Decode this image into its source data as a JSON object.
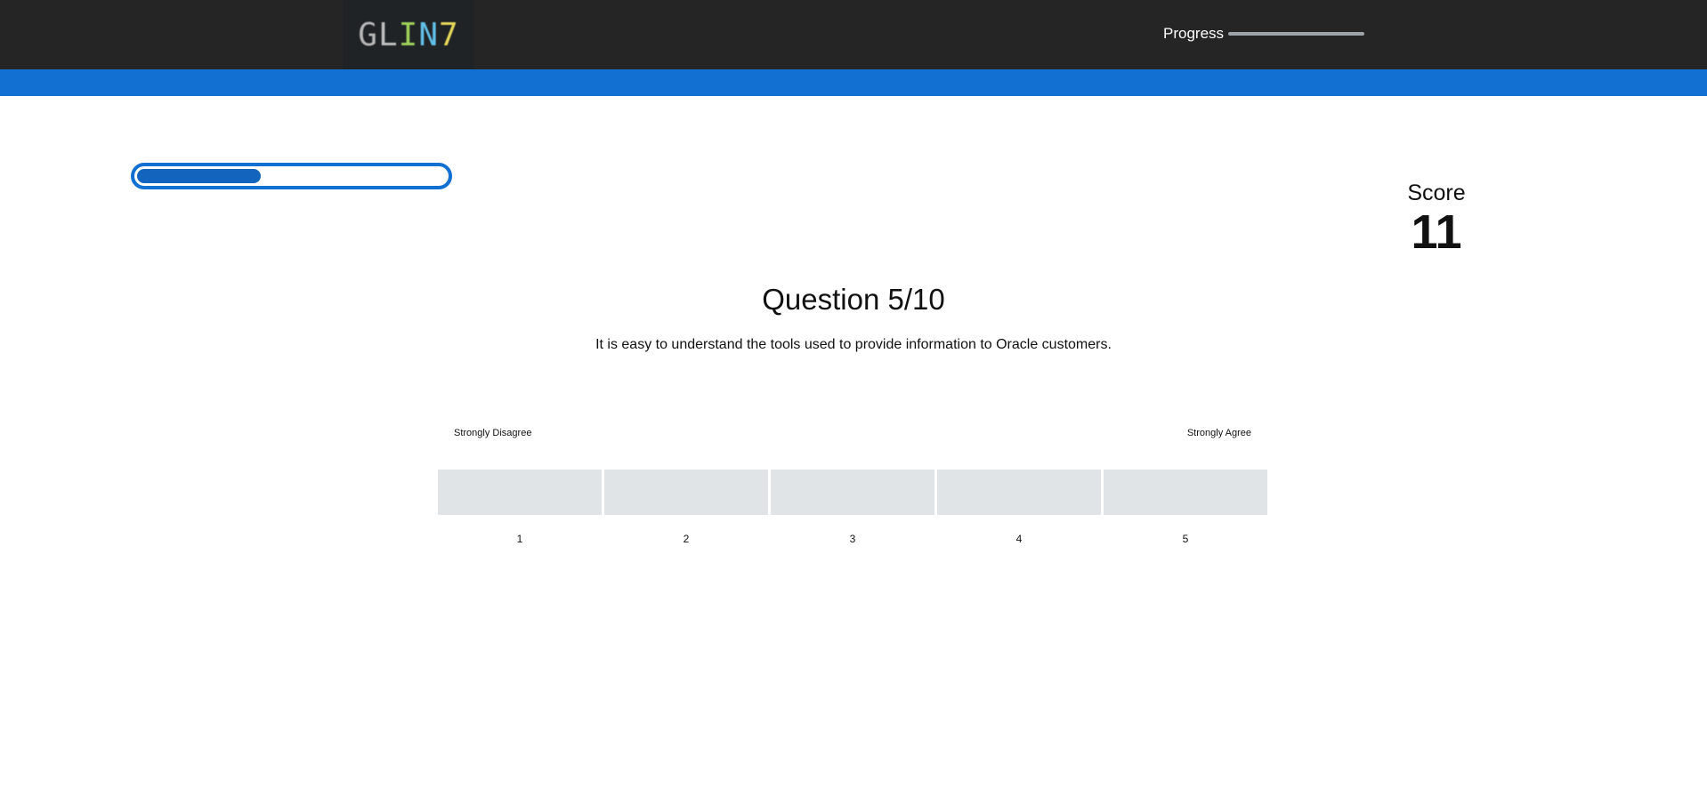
{
  "header": {
    "logo_text": [
      "G",
      "L",
      "I",
      "N",
      "7"
    ],
    "progress_label": "Progress",
    "progress_value": 0
  },
  "quiz_progress": {
    "value": 0.4
  },
  "score": {
    "label": "Score",
    "value": "11"
  },
  "question": {
    "title": "Question 5/10",
    "text": "It is easy to understand the tools used to provide information to Oracle customers."
  },
  "scale": {
    "low_label": "Strongly Disagree",
    "high_label": "Strongly Agree",
    "options": [
      "1",
      "2",
      "3",
      "4",
      "5"
    ]
  },
  "colors": {
    "topbar": "#252525",
    "accent_blue": "#1270d3",
    "option_bg": "#e1e4e7"
  }
}
